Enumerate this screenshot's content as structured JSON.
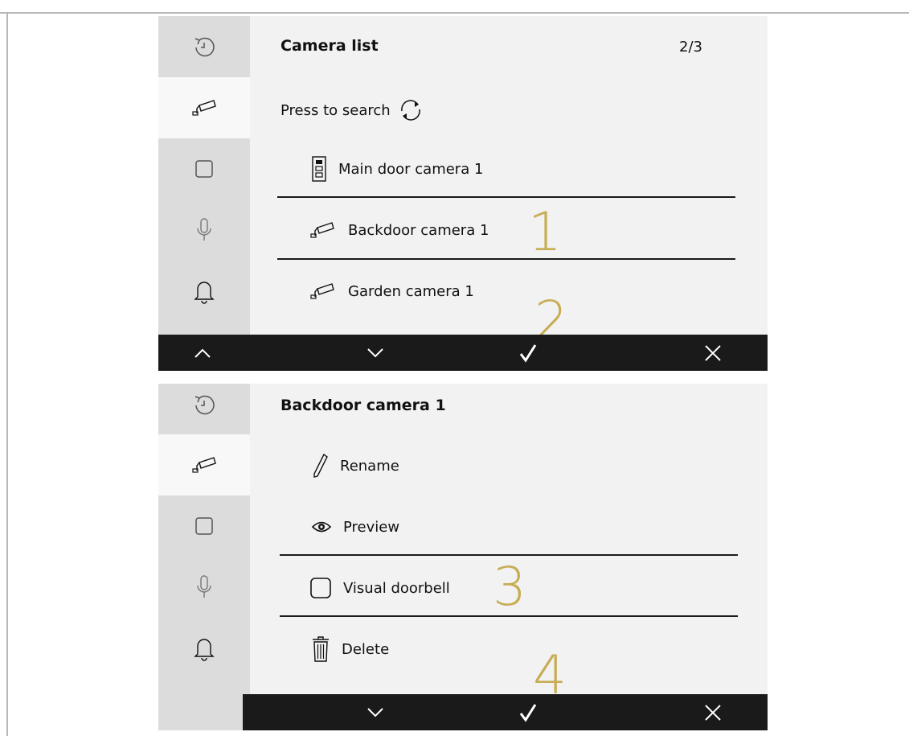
{
  "screen1": {
    "title": "Camera list",
    "page_count": "2/3",
    "search_label": "Press to search",
    "items": [
      {
        "label": "Main door camera 1",
        "icon": "door-station-icon"
      },
      {
        "label": "Backdoor camera 1",
        "icon": "camera-icon"
      },
      {
        "label": "Garden camera 1",
        "icon": "camera-icon"
      }
    ],
    "callouts": [
      "1",
      "2"
    ]
  },
  "screen2": {
    "title": "Backdoor camera 1",
    "items": [
      {
        "label": "Rename",
        "icon": "pencil-icon"
      },
      {
        "label": "Preview",
        "icon": "eye-icon"
      },
      {
        "label": "Visual doorbell",
        "icon": "checkbox-icon"
      },
      {
        "label": "Delete",
        "icon": "trash-icon"
      }
    ],
    "callouts": [
      "3",
      "4"
    ]
  },
  "sidebar_icons": [
    "history-icon",
    "camera-icon",
    "square-icon",
    "microphone-icon",
    "bell-icon"
  ],
  "bottom_bar_icons": [
    "chevron-up-icon",
    "chevron-down-icon",
    "check-icon",
    "close-icon"
  ],
  "colors": {
    "callout": "#c7ad55",
    "bar": "#1a1a1a",
    "sidebar": "#dcdcdc",
    "panel": "#f2f2f2"
  }
}
